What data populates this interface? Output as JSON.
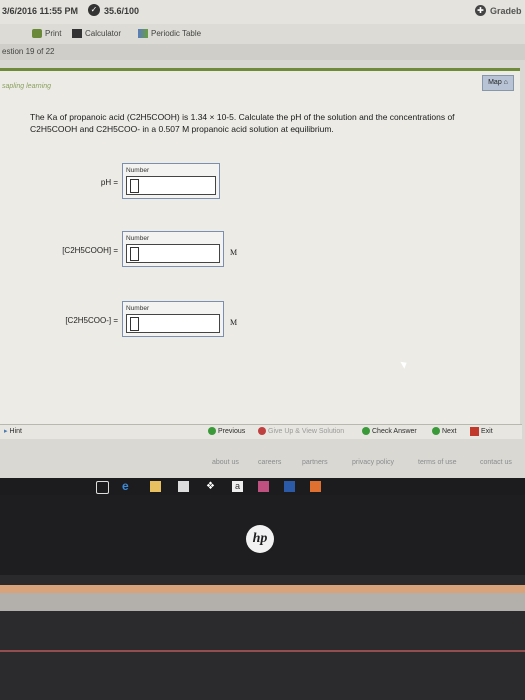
{
  "status": {
    "datetime": "3/6/2016 11:55 PM",
    "score": "35.6/100",
    "gradebook": "Gradeb"
  },
  "toolbar": {
    "print": "Print",
    "calculator": "Calculator",
    "periodic_table": "Periodic Table"
  },
  "question_bar": {
    "label": "estion 19 of 22"
  },
  "panel": {
    "brand": "sapling learning",
    "map_label": "Map",
    "question": "The Ka of propanoic acid (C2H5COOH) is 1.34 × 10-5. Calculate the pH of the solution and the concentrations of C2H5COOH and C2H5COO- in a 0.507 M propanoic acid solution at equilibrium."
  },
  "fields": [
    {
      "label": "pH =",
      "box_label": "Number",
      "unit": ""
    },
    {
      "label": "[C2H5COOH] =",
      "box_label": "Number",
      "unit": "M"
    },
    {
      "label": "[C2H5COO-] =",
      "box_label": "Number",
      "unit": "M"
    }
  ],
  "navbar": {
    "hint": "Hint",
    "previous": "Previous",
    "give_up": "Give Up & View Solution",
    "check": "Check Answer",
    "next": "Next",
    "exit": "Exit"
  },
  "footer": [
    "about us",
    "careers",
    "partners",
    "privacy policy",
    "terms of use",
    "contact us"
  ],
  "laptop": {
    "logo": "hp"
  },
  "colors": {
    "accent_green": "#6f8a3a",
    "check_green": "#3a9a3a",
    "exit_red": "#c0392b"
  }
}
